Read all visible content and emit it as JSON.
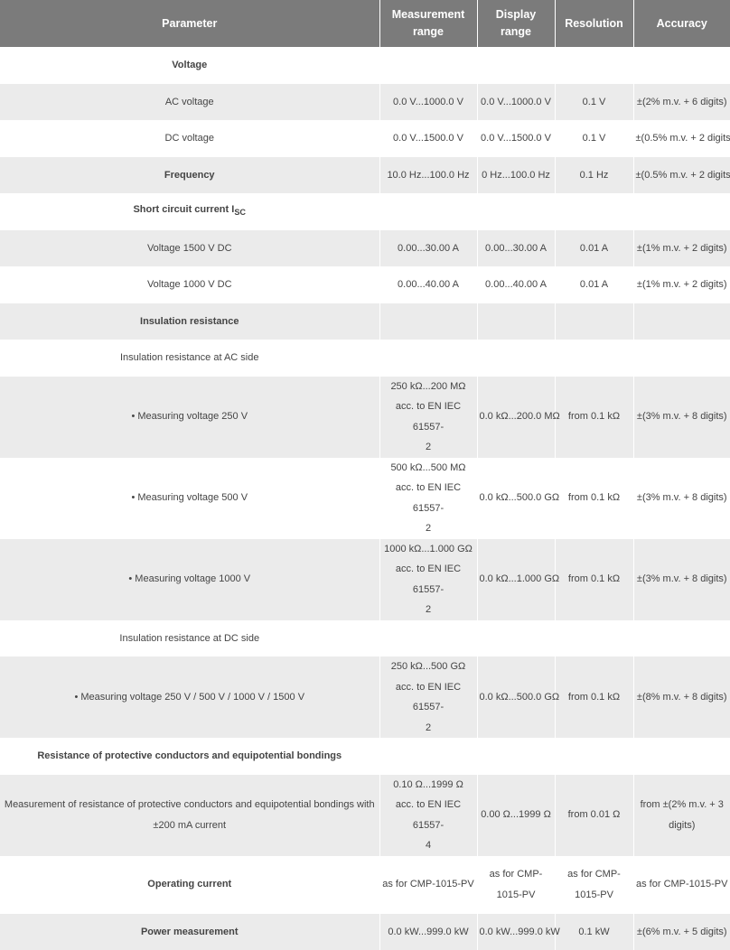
{
  "headers": {
    "parameter": "Parameter",
    "measurement_range": "Measurement range",
    "display_range": "Display range",
    "resolution": "Resolution",
    "accuracy": "Accuracy"
  },
  "rows": [
    {
      "param": "Voltage"
    },
    {
      "param": "AC voltage",
      "mr": "0.0 V...1000.0 V",
      "dr": "0.0 V...1000.0 V",
      "res": "0.1 V",
      "acc": "±(2% m.v. + 6 digits)"
    },
    {
      "param": "DC voltage",
      "mr": "0.0 V...1500.0 V",
      "dr": "0.0 V...1500.0 V",
      "res": "0.1 V",
      "acc": "±(0.5% m.v. + 2 digits)"
    },
    {
      "param": "Frequency",
      "mr": "10.0 Hz...100.0 Hz",
      "dr": "0 Hz...100.0 Hz",
      "res": "0.1 Hz",
      "acc": "±(0.5% m.v. + 2 digits)"
    },
    {
      "param": "Short circuit current I",
      "param_sub": "SC"
    },
    {
      "param": "Voltage 1500 V DC",
      "mr": "0.00...30.00 A",
      "dr": "0.00...30.00 A",
      "res": "0.01 A",
      "acc": "±(1% m.v. + 2 digits)"
    },
    {
      "param": "Voltage 1000 V DC",
      "mr": "0.00...40.00 A",
      "dr": "0.00...40.00 A",
      "res": "0.01 A",
      "acc": "±(1% m.v. + 2 digits)"
    },
    {
      "param": "Insulation resistance"
    },
    {
      "param": "Insulation resistance at AC side"
    },
    {
      "param": "• Measuring voltage 250 V",
      "mr_line1": "250 kΩ...200 MΩ",
      "mr_line2": "acc. to EN IEC 61557-",
      "mr_line3": "2",
      "dr": "0.0 kΩ...200.0 MΩ",
      "res": "from 0.1 kΩ",
      "acc": "±(3% m.v. + 8 digits)"
    },
    {
      "param": "• Measuring voltage 500 V",
      "mr_line1": "500 kΩ...500 MΩ",
      "mr_line2": "acc. to EN IEC 61557-",
      "mr_line3": "2",
      "dr": "0.0 kΩ...500.0 GΩ",
      "res": "from 0.1 kΩ",
      "acc": "±(3% m.v. + 8 digits)"
    },
    {
      "param": "• Measuring voltage 1000 V",
      "mr_line1": "1000 kΩ...1.000 GΩ",
      "mr_line2": "acc. to EN IEC 61557-",
      "mr_line3": "2",
      "dr": "0.0 kΩ...1.000 GΩ",
      "res": "from 0.1 kΩ",
      "acc": "±(3% m.v. + 8 digits)"
    },
    {
      "param": "Insulation resistance at DC side"
    },
    {
      "param": "• Measuring voltage 250 V / 500 V / 1000 V / 1500 V",
      "mr_line1": "250 kΩ...500 GΩ",
      "mr_line2": "acc. to EN IEC 61557-",
      "mr_line3": "2",
      "dr": "0.0 kΩ...500.0 GΩ",
      "res": "from 0.1 kΩ",
      "acc": "±(8% m.v. + 8 digits)"
    },
    {
      "param": "Resistance of protective conductors and equipotential bondings"
    },
    {
      "param": "Measurement of resistance of protective conductors and equipotential bondings with ±200 mA current",
      "mr_line1": "0.10 Ω...1999 Ω",
      "mr_line2": "acc. to EN IEC 61557-",
      "mr_line3": "4",
      "dr": "0.00 Ω...1999 Ω",
      "res": "from 0.01 Ω",
      "acc": "from ±(2% m.v. + 3 digits)"
    },
    {
      "param": "Operating current",
      "mr": "as for CMP-1015-PV",
      "dr": "as for CMP-1015-PV",
      "res": "as for CMP-1015-PV",
      "acc": "as for CMP-1015-PV"
    },
    {
      "param": "Power measurement",
      "mr": "0.0 kW...999.0 kW",
      "dr": "0.0 kW...999.0 kW",
      "res": "0.1 kW",
      "acc": "±(6% m.v. + 5 digits)"
    }
  ]
}
